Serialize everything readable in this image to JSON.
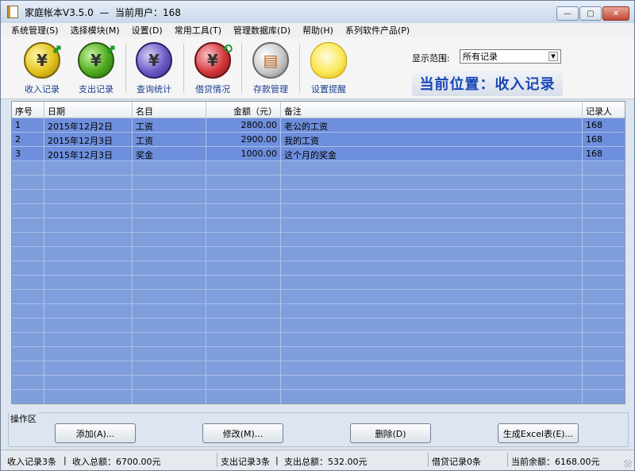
{
  "window": {
    "title": "家庭帐本V3.5.0  —  当前用户：168",
    "controls": {
      "minimize": "—",
      "maximize": "▢",
      "close": "✕"
    }
  },
  "menu": [
    "系统管理(S)",
    "选择模块(M)",
    "设置(D)",
    "常用工具(T)",
    "管理数据库(D)",
    "帮助(H)",
    "系列软件产品(P)"
  ],
  "toolbar": {
    "items": [
      {
        "label": "收入记录",
        "icon": "income-coin-icon",
        "glyph": "¥"
      },
      {
        "label": "支出记录",
        "icon": "expense-coin-icon",
        "glyph": "¥"
      },
      {
        "label": "查询统计",
        "icon": "query-stats-icon",
        "glyph": "¥"
      },
      {
        "label": "借贷情况",
        "icon": "loan-coin-icon",
        "glyph": "¥"
      },
      {
        "label": "存款管理",
        "icon": "deposit-icon",
        "glyph": "▤"
      },
      {
        "label": "设置提醒",
        "icon": "reminder-bulb-icon",
        "glyph": ""
      }
    ],
    "range_label": "显示范围:",
    "range_value": "所有记录",
    "location": "当前位置：收入记录"
  },
  "grid": {
    "headers": [
      "序号",
      "日期",
      "名目",
      "金额（元）",
      "备注",
      "记录人"
    ],
    "rows": [
      [
        "1",
        "2015年12月2日",
        "工资",
        "2800.00",
        "老公的工资",
        "168"
      ],
      [
        "2",
        "2015年12月3日",
        "工资",
        "2900.00",
        "我的工资",
        "168"
      ],
      [
        "3",
        "2015年12月3日",
        "奖金",
        "1000.00",
        "这个月的奖金",
        "168"
      ]
    ]
  },
  "ops": {
    "title": "操作区",
    "buttons": [
      "添加(A)...",
      "修改(M)...",
      "删除(D)",
      "生成Excel表(E)..."
    ]
  },
  "status": {
    "income_count": "收入记录3条",
    "income_total": "收入总额：6700.00元",
    "expense_count": "支出记录3条",
    "expense_total": "支出总额：532.00元",
    "loan_count": "借贷记录0条",
    "balance": "当前余额：6168.00元",
    "separator": "|"
  },
  "colors": {
    "row_selected": "#6e8fdc",
    "grid_empty": "#7f9edc",
    "location_text": "#1b47b6",
    "toolbar_label": "#1a3d8f"
  }
}
